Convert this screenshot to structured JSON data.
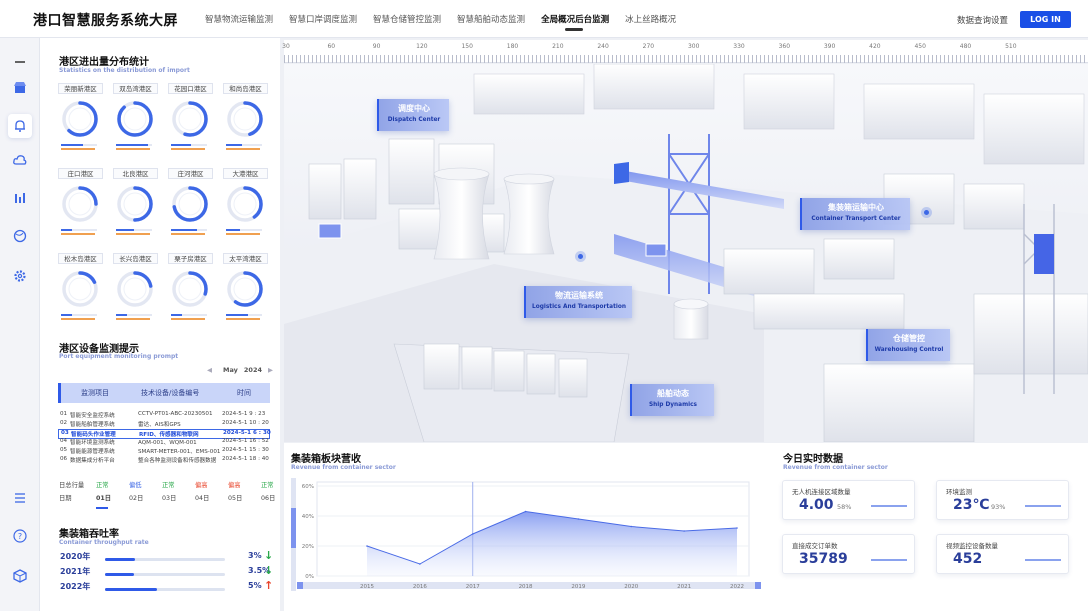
{
  "app": {
    "brand": "港口智慧服务系统大屏"
  },
  "nav": {
    "items": [
      "智慧物流运输监测",
      "智慧口岸调度监测",
      "智慧仓储管控监测",
      "智慧船舶动态监测",
      "全局概况后台监测",
      "冰上丝路概况"
    ],
    "active_index": 4,
    "query_settings": "数据查询设置",
    "login": "LOG IN"
  },
  "rail": {
    "icons": [
      "menu-dash-icon",
      "store-icon",
      "bell-icon",
      "cloud-icon",
      "bar-chart-icon",
      "globe-icon",
      "gear-icon",
      "list-icon",
      "help-icon",
      "box-icon"
    ],
    "active_index": 2
  },
  "distribution": {
    "title": "港区进出量分布统计",
    "subtitle": "Statistics on the distribution of import",
    "ports": [
      {
        "name": "荣丽新港区",
        "fill": 0.62
      },
      {
        "name": "双岛湾港区",
        "fill": 0.88
      },
      {
        "name": "花园口港区",
        "fill": 0.55
      },
      {
        "name": "和尚岛港区",
        "fill": 0.45
      },
      {
        "name": "庄口港区",
        "fill": 0.25
      },
      {
        "name": "北良港区",
        "fill": 0.5
      },
      {
        "name": "庄河港区",
        "fill": 0.72
      },
      {
        "name": "大港港区",
        "fill": 0.4
      },
      {
        "name": "松木岛港区",
        "fill": 0.18
      },
      {
        "name": "长兴岛港区",
        "fill": 0.22
      },
      {
        "name": "栗子房港区",
        "fill": 0.3
      },
      {
        "name": "太平湾港区",
        "fill": 0.6
      }
    ]
  },
  "monitoring": {
    "title": "港区设备监测提示",
    "subtitle": "Port equipment monitoring prompt",
    "month": "May",
    "year": "2024",
    "headers": [
      "监测项目",
      "技术设备/设备编号",
      "时间"
    ],
    "rows": [
      {
        "no": "01",
        "item": "智能安全监控系统",
        "device": "CCTV-PT01-ABC-20230501",
        "time": "2024-5-1 9 : 23",
        "selected": false
      },
      {
        "no": "02",
        "item": "智能船舶管理系统",
        "device": "雷达、AIS和GPS",
        "time": "2024-5-1 10 : 20",
        "selected": false
      },
      {
        "no": "03",
        "item": "智能码头作业管理",
        "device": "RFID、传感器和物联网",
        "time": "2024-5-1 6 : 30",
        "selected": true
      },
      {
        "no": "04",
        "item": "智能环境监测系统",
        "device": "AQM-001、WQM-001",
        "time": "2024-5-1 16 : 52",
        "selected": false
      },
      {
        "no": "05",
        "item": "智能能源管理系统",
        "device": "SMART-METER-001、EMS-001",
        "time": "2024-5-1 15 : 30",
        "selected": false
      },
      {
        "no": "06",
        "item": "数据集成分析平台",
        "device": "整合各种监测设备和传感器数据",
        "time": "2024-5-1 18 : 40",
        "selected": false
      }
    ],
    "status_row": {
      "label": "日总行量",
      "values": [
        "正常",
        "偏低",
        "正常",
        "偏高",
        "偏高",
        "正常"
      ]
    },
    "date_row": {
      "label": "日期",
      "values": [
        "01日",
        "02日",
        "03日",
        "04日",
        "05日",
        "06日"
      ]
    }
  },
  "throughput": {
    "title": "集装箱吞吐率",
    "subtitle": "Container throughput rate",
    "rows": [
      {
        "year": "2020年",
        "value": "3%",
        "fill": 0.25,
        "dir": "down"
      },
      {
        "year": "2021年",
        "value": "3.5%",
        "fill": 0.24,
        "dir": "down"
      },
      {
        "year": "2022年",
        "value": "5%",
        "fill": 0.43,
        "dir": "up"
      }
    ]
  },
  "ruler": {
    "ticks": [
      "30",
      "60",
      "90",
      "120",
      "150",
      "180",
      "210",
      "240",
      "270",
      "300",
      "330",
      "360",
      "390",
      "420",
      "450",
      "480",
      "510"
    ]
  },
  "scene": {
    "tags": [
      {
        "cn": "调度中心",
        "en": "Dispatch Center"
      },
      {
        "cn": "集装箱运输中心",
        "en": "Container Transport Center"
      },
      {
        "cn": "物流运输系统",
        "en": "Logistics And Transportation"
      },
      {
        "cn": "仓储管控",
        "en": "Warehousing Control"
      },
      {
        "cn": "船舶动态",
        "en": "Ship Dynamics"
      }
    ]
  },
  "revenue": {
    "title": "集装箱板块营收",
    "subtitle": "Revenue from container sector"
  },
  "chart_data": {
    "type": "area",
    "title": "",
    "x": [
      "2015",
      "2016",
      "2017",
      "2018",
      "2019",
      "2020",
      "2021",
      "2022"
    ],
    "values": [
      20,
      8,
      28,
      43,
      38,
      33,
      30,
      32
    ],
    "yticks": [
      "0%",
      "20%",
      "40%",
      "60%"
    ],
    "ylim": [
      0,
      60
    ],
    "highlight_x": "2017",
    "grid": true
  },
  "realtime": {
    "title": "今日实时数据",
    "subtitle": "Revenue from container sector",
    "metrics": [
      {
        "label": "无人机连接区域数量",
        "value": "4.00",
        "unit": "58%"
      },
      {
        "label": "环境监测",
        "value": "23℃",
        "unit": "93%"
      },
      {
        "label": "直接成交订单数",
        "value": "35789",
        "unit": ""
      },
      {
        "label": "视频监控设备数量",
        "value": "452",
        "unit": ""
      }
    ]
  },
  "colors": {
    "accent": "#1a4fe6",
    "navy": "#2a3e9a",
    "up": "#e8452c",
    "down": "#2aa84a"
  }
}
